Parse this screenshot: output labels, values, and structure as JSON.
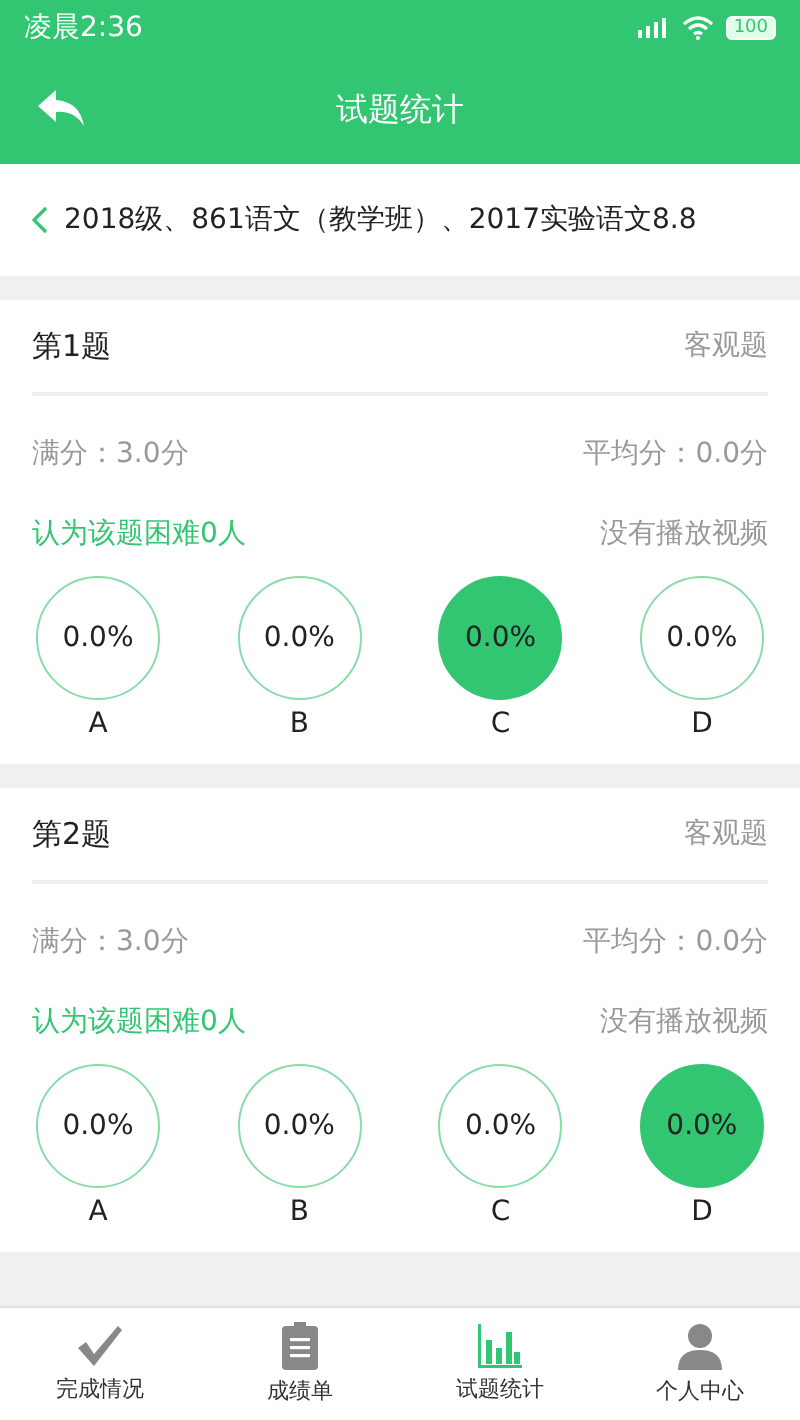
{
  "status_bar": {
    "time": "凌晨2:36",
    "battery": "100"
  },
  "header": {
    "title": "试题统计"
  },
  "breadcrumb": {
    "text": "2018级、861语文（教学班）、2017实验语文8.8"
  },
  "questions": [
    {
      "title": "第1题",
      "type": "客观题",
      "full_score": "满分：3.0分",
      "average": "平均分：0.0分",
      "difficulty": "认为该题困难0人",
      "video": "没有播放视频",
      "options": [
        {
          "label": "A",
          "percent": "0.0%",
          "correct": false
        },
        {
          "label": "B",
          "percent": "0.0%",
          "correct": false
        },
        {
          "label": "C",
          "percent": "0.0%",
          "correct": true
        },
        {
          "label": "D",
          "percent": "0.0%",
          "correct": false
        }
      ]
    },
    {
      "title": "第2题",
      "type": "客观题",
      "full_score": "满分：3.0分",
      "average": "平均分：0.0分",
      "difficulty": "认为该题困难0人",
      "video": "没有播放视频",
      "options": [
        {
          "label": "A",
          "percent": "0.0%",
          "correct": false
        },
        {
          "label": "B",
          "percent": "0.0%",
          "correct": false
        },
        {
          "label": "C",
          "percent": "0.0%",
          "correct": false
        },
        {
          "label": "D",
          "percent": "0.0%",
          "correct": true
        }
      ]
    }
  ],
  "tab_bar": [
    {
      "kind": "check",
      "label": "完成情况",
      "selected": false
    },
    {
      "kind": "clipboard",
      "label": "成绩单",
      "selected": false
    },
    {
      "kind": "chart",
      "label": "试题统计",
      "selected": true
    },
    {
      "kind": "person",
      "label": "个人中心",
      "selected": false
    }
  ]
}
